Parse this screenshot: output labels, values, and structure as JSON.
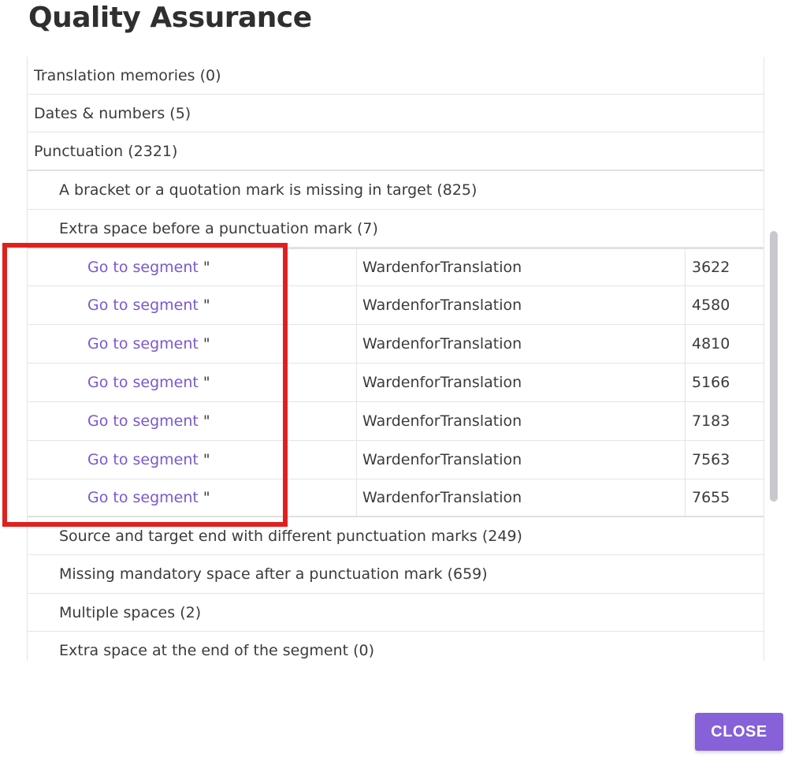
{
  "dialog": {
    "title": "Quality Assurance",
    "close_label": "CLOSE"
  },
  "categories": [
    {
      "label": "Translation memories (0)"
    },
    {
      "label": "Dates & numbers (5)"
    },
    {
      "label": "Punctuation (2321)"
    }
  ],
  "punctuation_checks_before": [
    {
      "label": "A bracket or a quotation mark is missing in target (825)"
    },
    {
      "label": "Extra space before a punctuation mark (7)"
    }
  ],
  "segments": [
    {
      "link": "Go to segment",
      "source": "\"",
      "author": "WardenforTranslation",
      "number": "3622"
    },
    {
      "link": "Go to segment",
      "source": "\"",
      "author": "WardenforTranslation",
      "number": "4580"
    },
    {
      "link": "Go to segment",
      "source": "\"",
      "author": "WardenforTranslation",
      "number": "4810"
    },
    {
      "link": "Go to segment",
      "source": "\"",
      "author": "WardenforTranslation",
      "number": "5166"
    },
    {
      "link": "Go to segment",
      "source": "\"",
      "author": "WardenforTranslation",
      "number": "7183"
    },
    {
      "link": "Go to segment",
      "source": "\"",
      "author": "WardenforTranslation",
      "number": "7563"
    },
    {
      "link": "Go to segment",
      "source": "\"",
      "author": "WardenforTranslation",
      "number": "7655"
    }
  ],
  "punctuation_checks_after": [
    {
      "label": "Source and target end with different punctuation marks (249)"
    },
    {
      "label": "Missing mandatory space after a punctuation mark (659)"
    },
    {
      "label": "Multiple spaces (2)"
    },
    {
      "label": "Extra space at the end of the segment (0)"
    }
  ],
  "colors": {
    "accent": "#8661d8",
    "link": "#7a57d1",
    "highlight": "#e0201e"
  }
}
